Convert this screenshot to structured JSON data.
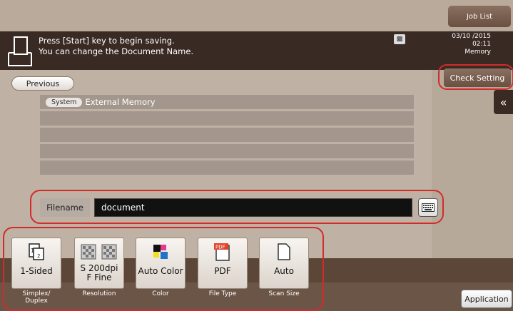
{
  "header": {
    "job_list_label": "Job List",
    "message_line1": "Press [Start] key to begin saving.",
    "message_line2": "You can change the Document Name.",
    "date": "03/10 /2015",
    "time": "02:11",
    "memory_label": "Memory"
  },
  "nav": {
    "previous_label": "Previous",
    "check_setting_label": "Check Setting",
    "collapse_glyph": "«"
  },
  "path": {
    "tag": "System",
    "location": "External Memory"
  },
  "filename": {
    "label": "Filename",
    "value": "document",
    "keyboard_icon": "keyboard-icon"
  },
  "settings": [
    {
      "value": "1-Sided",
      "label_line1": "Simplex/",
      "label_line2": "Duplex",
      "icon": "simplex-icon"
    },
    {
      "value_line1": "S 200dpi",
      "value_line2": "F Fine",
      "label": "Resolution",
      "icon": "resolution-icon"
    },
    {
      "value": "Auto Color",
      "label": "Color",
      "icon": "color-icon"
    },
    {
      "value": "PDF",
      "label": "File Type",
      "icon": "pdf-icon",
      "badge": "PDF"
    },
    {
      "value": "Auto",
      "label": "Scan Size",
      "icon": "scan-size-icon"
    }
  ],
  "application_label": "Application",
  "colors": {
    "highlight": "#d32b2b",
    "message_bar": "#3a2a24",
    "button_brown": "#7a5e4e"
  }
}
